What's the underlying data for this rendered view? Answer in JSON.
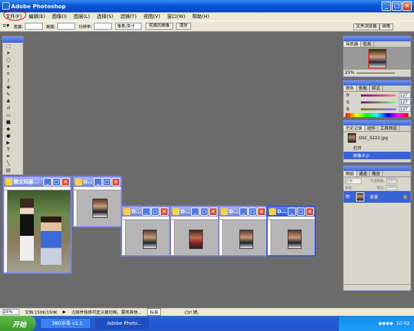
{
  "app": {
    "title": "Adobe Photoshop"
  },
  "menu": [
    "文件(F)",
    "编辑(E)",
    "图像(I)",
    "图层(L)",
    "选择(S)",
    "滤镜(T)",
    "视图(V)",
    "窗口(W)",
    "帮助(H)"
  ],
  "options": {
    "width_label": "宽度:",
    "height_label": "高度:",
    "resolution_label": "分辨率:",
    "unit_select": "像素/英寸",
    "front_image_button": "前面的图像",
    "clear_button": "清除",
    "well_tabs": [
      "文件浏览器",
      "画笔"
    ]
  },
  "documents": [
    {
      "title": "欧文玛丽...",
      "active": false
    },
    {
      "title": "D...",
      "active": false
    },
    {
      "title": "D...",
      "active": false
    },
    {
      "title": "D...",
      "active": false
    },
    {
      "title": "D...",
      "active": false
    },
    {
      "title": "D...",
      "active": true
    }
  ],
  "navigator": {
    "tabs": [
      "导航器",
      "信息"
    ],
    "zoom": "25%"
  },
  "color_panel": {
    "tabs": [
      "颜色",
      "色板",
      "样式"
    ],
    "r_label": "R",
    "g_label": "G",
    "b_label": "B",
    "r": "127",
    "g": "127",
    "b": "127"
  },
  "history": {
    "tabs": [
      "历史记录",
      "动作",
      "工具预设"
    ],
    "snapshot": "DSC_0222.jpg",
    "items": [
      "打开",
      "图像大小"
    ]
  },
  "layers": {
    "tabs": [
      "图层",
      "通道",
      "路径"
    ],
    "blend": "正常",
    "opacity_label": "不透明度:",
    "opacity": "100%",
    "lock_label": "锁定:",
    "fill_label": "填充:",
    "fill": "100%",
    "layer_name": "背景"
  },
  "status": {
    "zoom": "25%",
    "doc": "文档:150K/150K",
    "hint": "点按并拖移可定义裁切框。要用其他...",
    "ime": "标准",
    "ctrl": "Ctrl 键。"
  },
  "taskbar": {
    "start": "开始",
    "tasks": [
      "360杀毒 v1.1",
      "Adobe Photo..."
    ],
    "clock": "10:02"
  }
}
